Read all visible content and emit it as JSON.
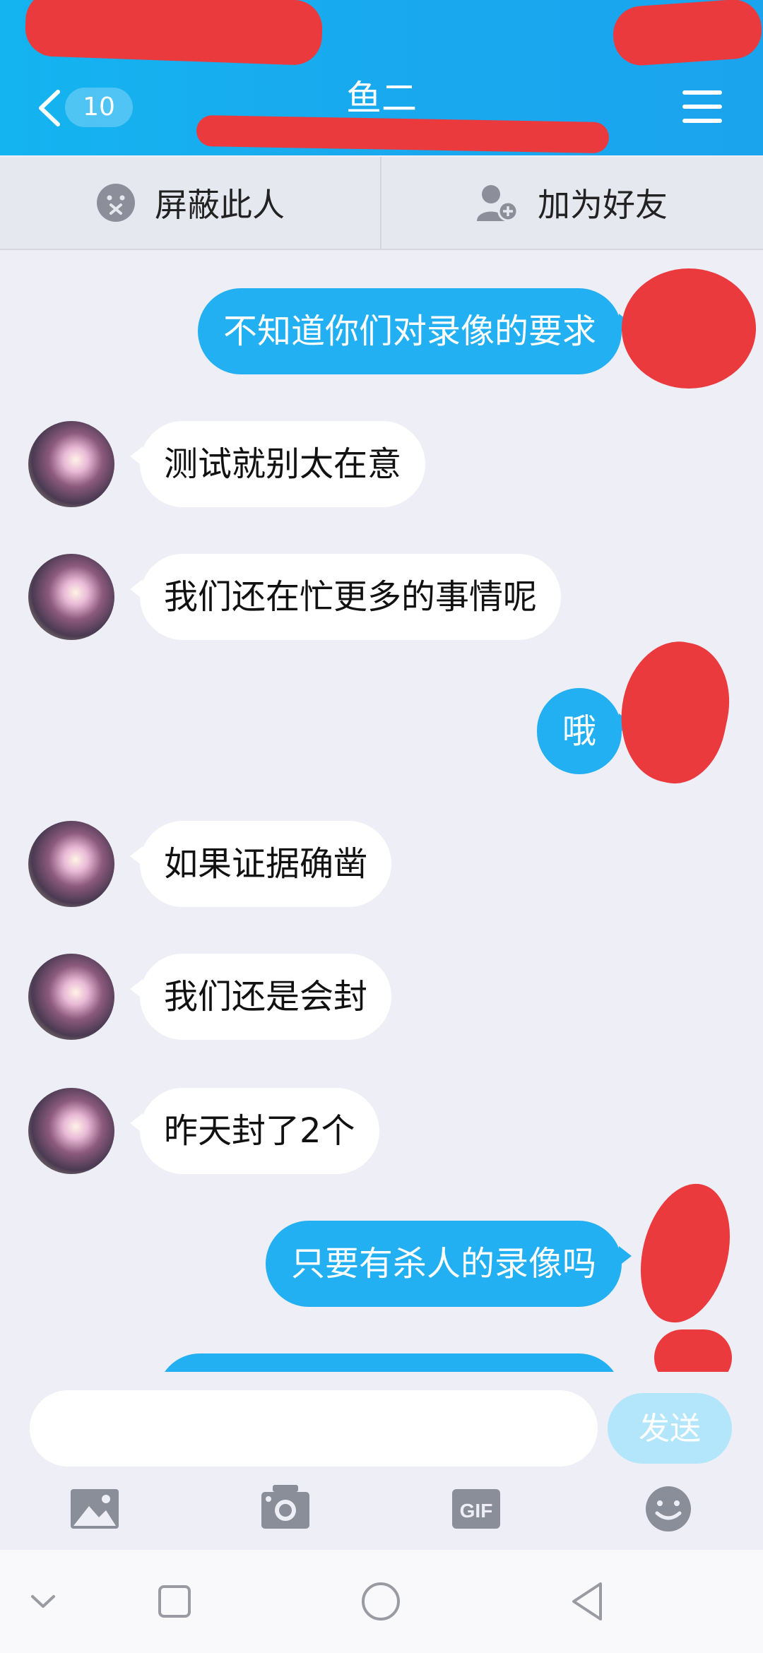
{
  "header": {
    "title": "鱼二",
    "unread_count": "10",
    "gradient_colors": [
      "#14b4f0",
      "#1aa4ee"
    ],
    "redaction_color": "#ea3a3e"
  },
  "actions": {
    "block_label": "屏蔽此人",
    "block_icon": "block-user-icon",
    "add_friend_label": "加为好友",
    "add_friend_icon": "add-friend-icon"
  },
  "messages": [
    {
      "side": "out",
      "text": "不知道你们对录像的要求"
    },
    {
      "side": "in",
      "text": "测试就别太在意"
    },
    {
      "side": "in",
      "text": "我们还在忙更多的事情呢"
    },
    {
      "side": "out",
      "text": "哦"
    },
    {
      "side": "in",
      "text": "如果证据确凿"
    },
    {
      "side": "in",
      "text": "我们还是会封"
    },
    {
      "side": "in",
      "text": "昨天封了2个"
    },
    {
      "side": "out",
      "text": "只要有杀人的录像吗"
    }
  ],
  "bubble_colors": {
    "incoming": "#ffffff",
    "outgoing": "#23b0f2"
  },
  "composer": {
    "placeholder": "",
    "send_label": "发送",
    "tools": [
      "image-icon",
      "camera-icon",
      "gif-icon",
      "emoji-icon"
    ]
  },
  "navbar": {
    "keys": [
      "collapse-icon",
      "recents-icon",
      "home-icon",
      "back-icon"
    ]
  }
}
